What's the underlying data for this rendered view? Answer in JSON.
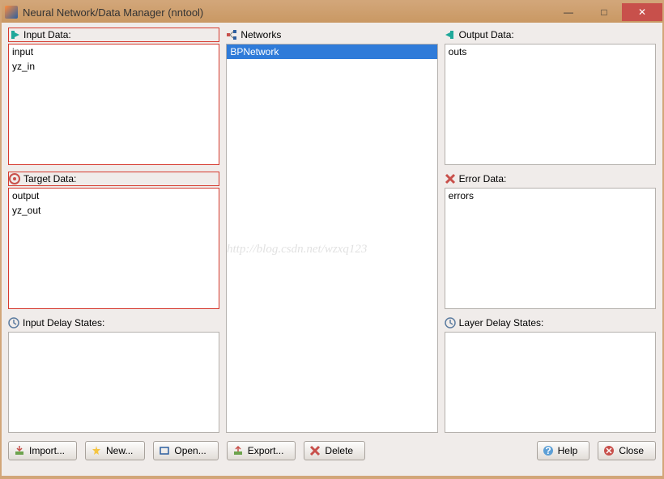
{
  "title": "Neural Network/Data Manager (nntool)",
  "panels": {
    "input_data": {
      "label": "Input Data:",
      "items": [
        "input",
        "yz_in"
      ]
    },
    "target_data": {
      "label": "Target Data:",
      "items": [
        "output",
        "yz_out"
      ]
    },
    "input_delay": {
      "label": "Input Delay States:"
    },
    "networks": {
      "label": "Networks",
      "items": [
        "BPNetwork"
      ],
      "selected": 0
    },
    "output_data": {
      "label": "Output Data:",
      "items": [
        "outs"
      ]
    },
    "error_data": {
      "label": "Error Data:",
      "items": [
        "errors"
      ]
    },
    "layer_delay": {
      "label": "Layer Delay States:"
    }
  },
  "buttons": {
    "import": "Import...",
    "new": "New...",
    "open": "Open...",
    "export": "Export...",
    "delete": "Delete",
    "help": "Help",
    "close": "Close"
  },
  "watermark": "http://blog.csdn.net/wzxq123"
}
